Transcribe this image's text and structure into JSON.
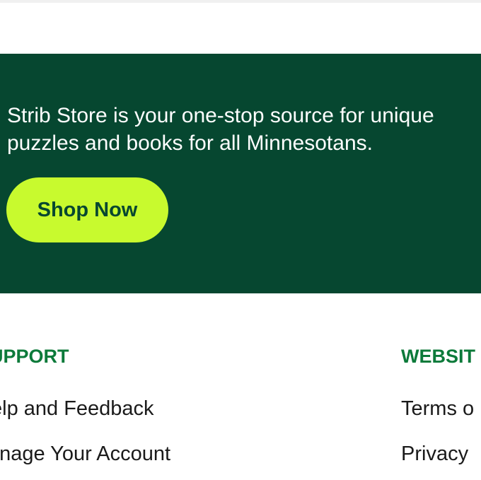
{
  "promo": {
    "text_line1": "Strib Store is your one-stop source for unique",
    "text_line2": "puzzles and books for all Minnesotans.",
    "button_label": "Shop Now"
  },
  "footer": {
    "columns": [
      {
        "heading": "UPPORT",
        "links": [
          "elp and Feedback",
          "anage Your Account"
        ]
      },
      {
        "heading": "WEBSIT",
        "links": [
          "Terms o",
          "Privacy"
        ]
      }
    ]
  },
  "colors": {
    "promo_background": "#064730",
    "button_background": "#c8fa2e",
    "heading_color": "#0c7a3a"
  }
}
